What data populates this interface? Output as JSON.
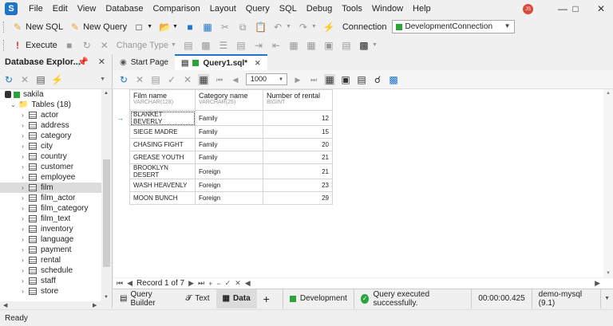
{
  "menu": {
    "items": [
      "File",
      "Edit",
      "View",
      "Database",
      "Comparison",
      "Layout",
      "Query",
      "SQL",
      "Debug",
      "Tools",
      "Window",
      "Help"
    ],
    "avatar_initials": "JS"
  },
  "toolbar1": {
    "new_sql": "New SQL",
    "new_query": "New Query",
    "connection_label": "Connection",
    "connection_value": "DevelopmentConnection"
  },
  "toolbar2": {
    "execute": "Execute",
    "change_type": "Change Type"
  },
  "explorer": {
    "title": "Database Explor...",
    "db_name": "sakila",
    "tables_label": "Tables (18)",
    "tables": [
      "actor",
      "address",
      "category",
      "city",
      "country",
      "customer",
      "employee",
      "film",
      "film_actor",
      "film_category",
      "film_text",
      "inventory",
      "language",
      "payment",
      "rental",
      "schedule",
      "staff",
      "store"
    ],
    "selected": "film"
  },
  "tabs": {
    "start_page": "Start Page",
    "query": "Query1.sql*"
  },
  "query_toolbar": {
    "page_size": "1000"
  },
  "grid": {
    "columns": [
      {
        "name": "Film name",
        "type": "VARCHAR(128)"
      },
      {
        "name": "Category name",
        "type": "VARCHAR(25)"
      },
      {
        "name": "Number of rental",
        "type": "BIGINT"
      }
    ],
    "rows": [
      [
        "BLANKET BEVERLY",
        "Family",
        "12"
      ],
      [
        "SIEGE MADRE",
        "Family",
        "15"
      ],
      [
        "CHASING FIGHT",
        "Family",
        "20"
      ],
      [
        "GREASE YOUTH",
        "Family",
        "21"
      ],
      [
        "BROOKLYN DESERT",
        "Foreign",
        "21"
      ],
      [
        "WASH HEAVENLY",
        "Foreign",
        "23"
      ],
      [
        "MOON BUNCH",
        "Foreign",
        "29"
      ]
    ]
  },
  "record_bar": {
    "record_text": "Record 1 of 7"
  },
  "bottom": {
    "query_builder": "Query Builder",
    "text": "Text",
    "data": "Data",
    "add": "+",
    "environment": "Development",
    "status": "Query executed successfully.",
    "duration": "00:00:00.425",
    "connection": "demo-mysql (9.1)"
  },
  "status_bar": {
    "text": "Ready"
  },
  "colors": {
    "accent": "#1e74c6",
    "success": "#2aa53a"
  }
}
